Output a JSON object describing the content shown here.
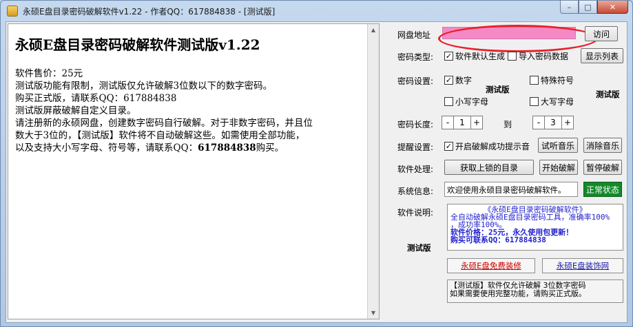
{
  "window": {
    "title": "永硕E盘目录密码破解软件v1.22 - 作者QQ：617884838 - [测试版]",
    "minimize": "–",
    "maximize": "□",
    "close": "✕"
  },
  "left": {
    "title": "永硕E盘目录密码破解软件测试版v1.22",
    "lines": [
      "软件售价：25元",
      "测试版功能有限制，测试版仅允许破解3位数以下的数字密码。",
      "购买正式版，请联系QQ：617884838",
      "测试版屏蔽破解自定义目录。",
      "请注册新的永硕网盘，创建数字密码自行破解。对于非数字密码，并且位",
      "数大于3位的，【测试版】软件将不自动破解这些。如需使用全部功能，"
    ],
    "last_line_prefix": "以及支持大小写字母、符号等，请联系QQ：",
    "last_line_qq": "617884838",
    "last_line_suffix": "购买。"
  },
  "right": {
    "disk_address_label": "网盘地址",
    "visit_button": "访问",
    "pwd_type_label": "密码类型:",
    "software_default": "软件默认生成",
    "import_pwd": "导入密码数据",
    "show_list": "显示列表",
    "pwd_setting_label": "密码设置:",
    "digits": "数字",
    "special": "特殊符号",
    "lowercase": "小写字母",
    "uppercase": "大写字母",
    "test_tag_1": "测试版",
    "test_tag_2": "测试版",
    "pwd_length_label": "密码长度:",
    "minus": "-",
    "plus": "+",
    "len_from": "1",
    "to_label": "到",
    "len_to": "3",
    "reminder_label": "提醒设置:",
    "enable_reminder": "开启破解成功提示音",
    "listen_music": "试听音乐",
    "cancel_music": "消除音乐",
    "process_label": "软件处理:",
    "get_locked": "获取上锁的目录",
    "start_crack": "开始破解",
    "pause_crack": "暂停破解",
    "sysinfo_label": "系统信息:",
    "sysinfo_value": "欢迎使用永硕目录密码破解软件。",
    "status": "正常状态",
    "desc_label": "软件说明:",
    "test_tag_3": "测试版",
    "desc_lines": [
      "《永硕E盘目录密码破解软件》",
      "全自动破解永硕E盘目录密码工具，准确率100%",
      "，成功率100%。",
      "软件价格：25元，永久使用包更新！",
      "购买可联系QQ：617884838"
    ],
    "link_free_decor": "永硕E盘免费装修",
    "link_decor_site": "永硕E盘装饰网",
    "notice_lines": [
      "【测试版】软件仅允许破解 3位数字密码",
      "如果需要使用完整功能，请购买正式版。"
    ]
  },
  "colors": {
    "link_red": "#cc0000",
    "link_blue": "#1a1aa8",
    "status_green": "#138a2a",
    "address_pink": "#f489c6",
    "highlight_red": "#e8202a"
  }
}
